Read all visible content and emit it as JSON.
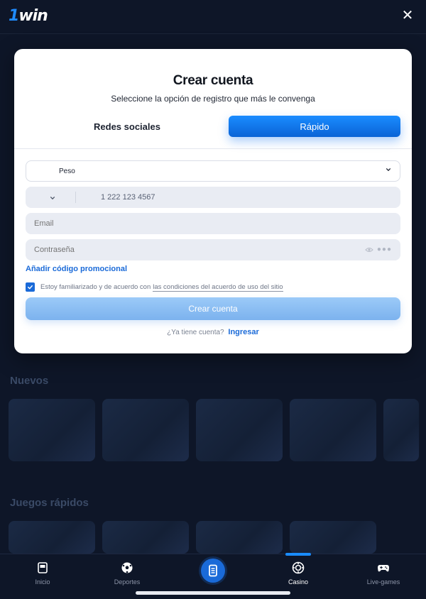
{
  "app": {
    "logo_one": "1",
    "logo_win": "win",
    "close_label": "✕"
  },
  "background": {
    "section_new": "Nuevos",
    "section_quick": "Juegos rápidos"
  },
  "modal": {
    "title": "Crear cuenta",
    "subtitle": "Seleccione la opción de registro que más le convenga",
    "tabs": [
      {
        "label": "Redes sociales",
        "active": false
      },
      {
        "label": "Rápido",
        "active": true
      }
    ],
    "currency": {
      "value": "Peso"
    },
    "phone": {
      "value": "1 222 123 4567"
    },
    "email": {
      "placeholder": "Email"
    },
    "password": {
      "placeholder": "Contraseña"
    },
    "promo_link": "Añadir código promocional",
    "terms": {
      "checked": true,
      "text": "Estoy familiarizado y de acuerdo con",
      "link": "las condiciones del acuerdo de uso del sitio"
    },
    "submit_label": "Crear cuenta",
    "login_prompt": "¿Ya tiene cuenta?",
    "login_link": "Ingresar"
  },
  "bottom_nav": {
    "items": [
      {
        "label": "Inicio",
        "icon": "home-icon",
        "active": false
      },
      {
        "label": "Deportes",
        "icon": "soccer-ball-icon",
        "active": false
      },
      {
        "label": "",
        "icon": "ticket-icon",
        "active": false
      },
      {
        "label": "Casino",
        "icon": "casino-chip-icon",
        "active": true
      },
      {
        "label": "Live-games",
        "icon": "gamepad-icon",
        "active": false
      }
    ]
  },
  "colors": {
    "accent": "#1a6ad8",
    "tab_active": "#1a8cff",
    "background": "#0e1628"
  }
}
